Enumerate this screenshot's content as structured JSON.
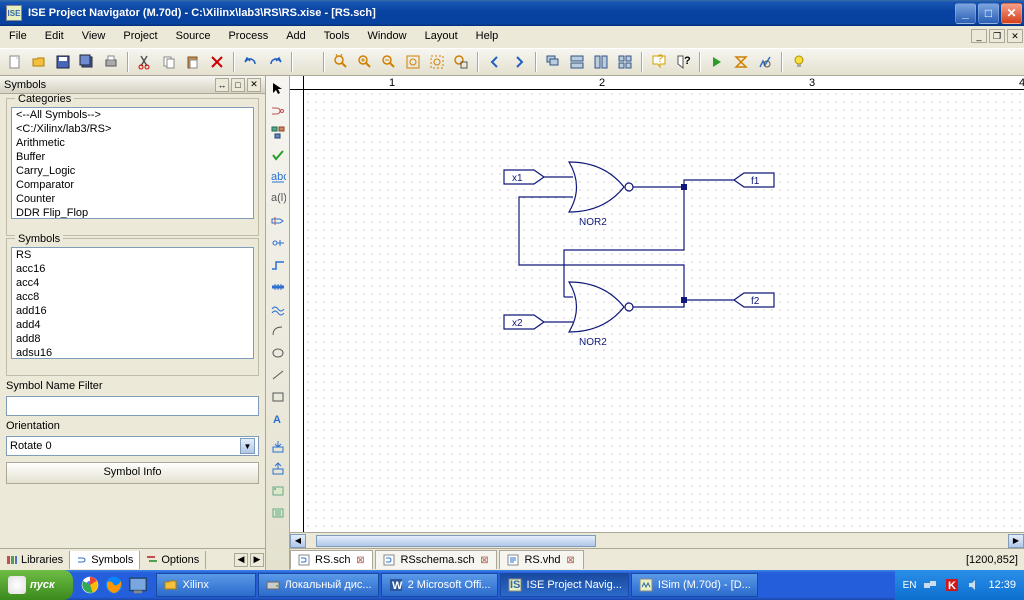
{
  "title": "ISE Project Navigator (M.70d) - C:\\Xilinx\\lab3\\RS\\RS.xise - [RS.sch]",
  "menu": [
    "File",
    "Edit",
    "View",
    "Project",
    "Source",
    "Process",
    "Add",
    "Tools",
    "Window",
    "Layout",
    "Help"
  ],
  "panel": {
    "title": "Symbols",
    "categories_label": "Categories",
    "categories": [
      "<--All Symbols-->",
      "<C:/Xilinx/lab3/RS>",
      "Arithmetic",
      "Buffer",
      "Carry_Logic",
      "Comparator",
      "Counter",
      "DDR Flip_Flop"
    ],
    "symbols_label": "Symbols",
    "symbols": [
      "RS",
      "acc16",
      "acc4",
      "acc8",
      "add16",
      "add4",
      "add8",
      "adsu16"
    ],
    "filter_label": "Symbol Name Filter",
    "filter_value": "",
    "orientation_label": "Orientation",
    "orientation_value": "Rotate 0",
    "info_btn": "Symbol Info",
    "tabs": [
      {
        "label": "Libraries",
        "icon": "libraries"
      },
      {
        "label": "Symbols",
        "icon": "symbols",
        "active": true
      },
      {
        "label": "Options",
        "icon": "options"
      }
    ]
  },
  "ruler_marks": [
    1,
    2,
    3,
    4
  ],
  "schematic": {
    "gates": [
      {
        "label": "NOR2",
        "inputs": [
          "x1"
        ],
        "output": "f1"
      },
      {
        "label": "NOR2",
        "inputs": [
          "x2"
        ],
        "output": "f2"
      }
    ],
    "io": {
      "x1": "x1",
      "x2": "x2",
      "f1": "f1",
      "f2": "f2"
    }
  },
  "doc_tabs": [
    {
      "label": "RS.sch",
      "icon": "sch",
      "active": true
    },
    {
      "label": "RSschema.sch",
      "icon": "sch"
    },
    {
      "label": "RS.vhd",
      "icon": "vhd"
    }
  ],
  "coords": "[1200,852]",
  "taskbar": {
    "start": "пуск",
    "items": [
      {
        "label": "Xilinx",
        "icon": "folder"
      },
      {
        "label": "Локальный дис...",
        "icon": "drive"
      },
      {
        "label": "2 Microsoft Offi...",
        "icon": "word"
      },
      {
        "label": "ISE Project Navig...",
        "icon": "ise",
        "active": true
      },
      {
        "label": "ISim (M.70d) - [D...",
        "icon": "isim"
      }
    ],
    "lang": "EN",
    "clock": "12:39"
  }
}
